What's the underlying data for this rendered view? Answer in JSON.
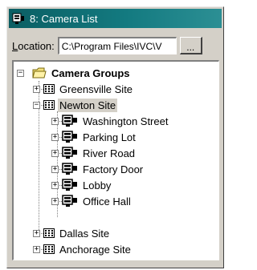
{
  "window": {
    "title": "8: Camera List"
  },
  "location": {
    "label_accel": "L",
    "label_rest": "ocation:",
    "value": "C:\\Program Files\\IVC\\V",
    "browse_label": "..."
  },
  "tree": {
    "root": {
      "label": "Camera Groups",
      "expander": "−"
    },
    "sites": [
      {
        "label": "Greensville Site",
        "expander": "+"
      },
      {
        "label": "Newton Site",
        "expander": "−"
      },
      {
        "label": "Dallas Site",
        "expander": "+"
      },
      {
        "label": "Anchorage Site",
        "expander": "+"
      }
    ],
    "cameras": [
      {
        "label": "Washington Street",
        "expander": "+"
      },
      {
        "label": "Parking Lot",
        "expander": "+"
      },
      {
        "label": "River Road",
        "expander": "+"
      },
      {
        "label": "Factory Door",
        "expander": "+"
      },
      {
        "label": "Lobby",
        "expander": "+"
      },
      {
        "label": "Office Hall",
        "expander": "+"
      }
    ],
    "selected": "Newton Site"
  }
}
